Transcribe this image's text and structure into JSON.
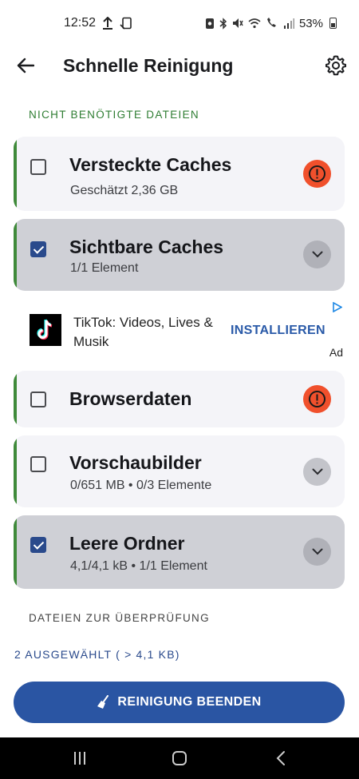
{
  "status_bar": {
    "time": "12:52",
    "battery_text": "53%",
    "icons": [
      "upload-icon",
      "screencast-icon",
      "nfc-icon",
      "bluetooth-icon",
      "mute-icon",
      "wifi-icon",
      "wifi-calling-icon",
      "signal-icon",
      "battery-icon"
    ]
  },
  "header": {
    "title": "Schnelle Reinigung",
    "back_icon": "arrow-back-icon",
    "settings_icon": "gear-icon"
  },
  "sections": {
    "unneeded": "NICHT BENÖTIGTE DATEIEN",
    "review": "DATEIEN ZUR ÜBERPRÜFUNG"
  },
  "items": [
    {
      "title": "Versteckte Caches",
      "subtitle": "Geschätzt 2,36 GB",
      "checked": false,
      "action": "warning-icon"
    },
    {
      "title": "Sichtbare Caches",
      "subtitle": "1/1 Element",
      "checked": true,
      "action": "chevron-down-icon"
    },
    {
      "title": "Browserdaten",
      "subtitle": "",
      "checked": false,
      "action": "warning-icon"
    },
    {
      "title": "Vorschaubilder",
      "subtitle": "0/651 MB • 0/3 Elemente",
      "checked": false,
      "action": "chevron-down-icon"
    },
    {
      "title": "Leere Ordner",
      "subtitle": "4,1/4,1 kB • 1/1 Element",
      "checked": true,
      "action": "chevron-down-icon"
    }
  ],
  "ad": {
    "title": "TikTok: Videos, Lives & Musik",
    "cta": "INSTALLIEREN",
    "badge": "Ad"
  },
  "selection_info": "2 AUSGEWÄHLT ( > 4,1 KB)",
  "primary_button": {
    "label": "REINIGUNG BEENDEN",
    "icon": "broom-icon"
  },
  "colors": {
    "accent_green": "#3f8a3a",
    "primary_blue": "#2a55a3",
    "checkbox_blue": "#2a4a8c",
    "warning_red": "#f0502c"
  }
}
